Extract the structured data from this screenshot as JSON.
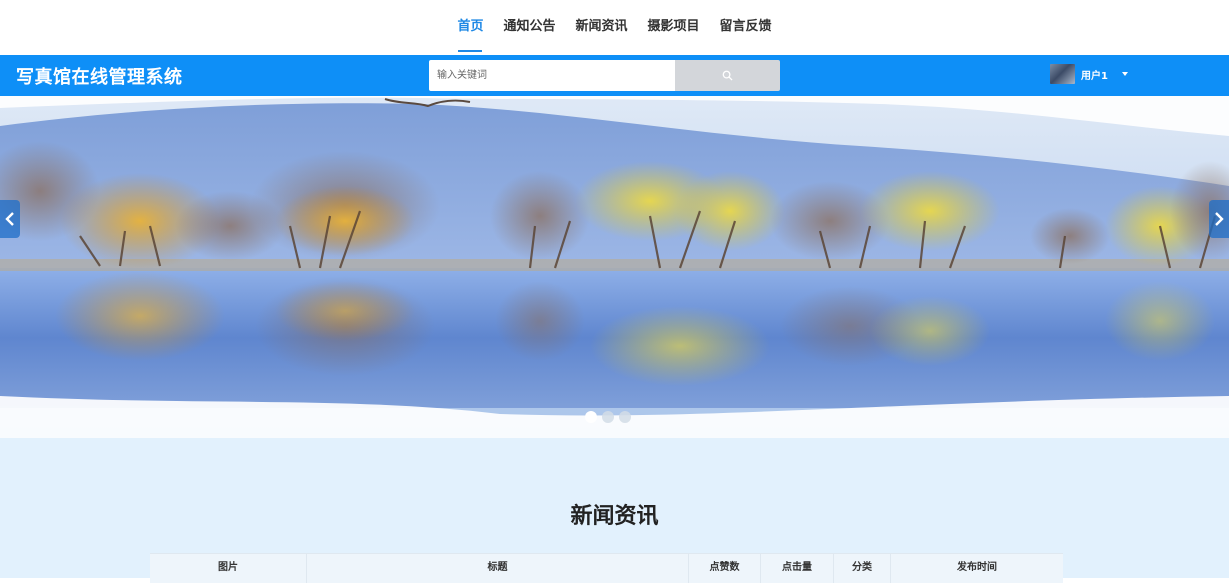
{
  "nav": {
    "items": [
      {
        "label": "首页",
        "active": true
      },
      {
        "label": "通知公告",
        "active": false
      },
      {
        "label": "新闻资讯",
        "active": false
      },
      {
        "label": "摄影项目",
        "active": false
      },
      {
        "label": "留言反馈",
        "active": false
      }
    ]
  },
  "header": {
    "title": "写真馆在线管理系统",
    "search": {
      "placeholder": "输入关键词",
      "value": "",
      "button_icon": "search-icon"
    },
    "user": {
      "name": "用户1",
      "menu_icon": "caret-down-icon"
    },
    "bar_color": "#0e8ff7"
  },
  "carousel": {
    "slide_count": 3,
    "active_index": 0,
    "prev_icon": "chevron-left-icon",
    "next_icon": "chevron-right-icon"
  },
  "news": {
    "section_title": "新闻资讯",
    "columns": [
      "图片",
      "标题",
      "点赞数",
      "点击量",
      "分类",
      "发布时间"
    ]
  },
  "colors": {
    "accent": "#1e88e5",
    "section_bg": "#e2f1fd"
  }
}
